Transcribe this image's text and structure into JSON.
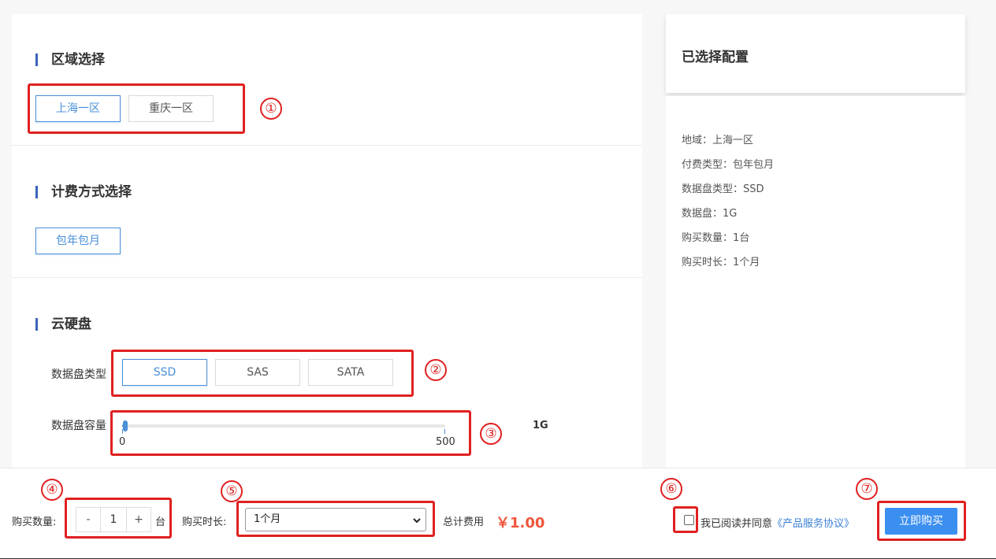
{
  "region": {
    "title": "区域选择",
    "options": [
      {
        "label": "上海一区",
        "active": true
      },
      {
        "label": "重庆一区",
        "active": false
      }
    ]
  },
  "billing": {
    "title": "计费方式选择",
    "options": [
      {
        "label": "包年包月",
        "active": true
      }
    ]
  },
  "disk": {
    "title": "云硬盘",
    "type_label": "数据盘类型",
    "types": [
      {
        "label": "SSD",
        "active": true
      },
      {
        "label": "SAS",
        "active": false
      },
      {
        "label": "SATA",
        "active": false
      }
    ],
    "capacity_label": "数据盘容量",
    "capacity_min": "0",
    "capacity_max": "500",
    "capacity_value": 1,
    "capacity_display": "1G"
  },
  "summary": {
    "title": "已选择配置",
    "items": [
      "地域：上海一区",
      "付费类型：包年包月",
      "数据盘类型：SSD",
      "数据盘：1G",
      "购买数量：1台",
      "购买时长：1个月"
    ]
  },
  "footer": {
    "quantity_label": "购买数量:",
    "decrement": "-",
    "quantity": "1",
    "increment": "+",
    "unit": "台",
    "duration_label": "购买时长:",
    "duration_value": "1个月",
    "total_label": "总计费用",
    "total_price": "￥1.00",
    "agree_text": "我已阅读并同意",
    "agree_link": "《产品服务协议》",
    "buy_label": "立即购买"
  },
  "annotations": [
    "①",
    "②",
    "③",
    "④",
    "⑤",
    "⑥",
    "⑦"
  ],
  "colors": {
    "accent": "#4a90d9",
    "highlight": "#e02020",
    "price": "#f0563b",
    "button": "#3b8ff0"
  }
}
